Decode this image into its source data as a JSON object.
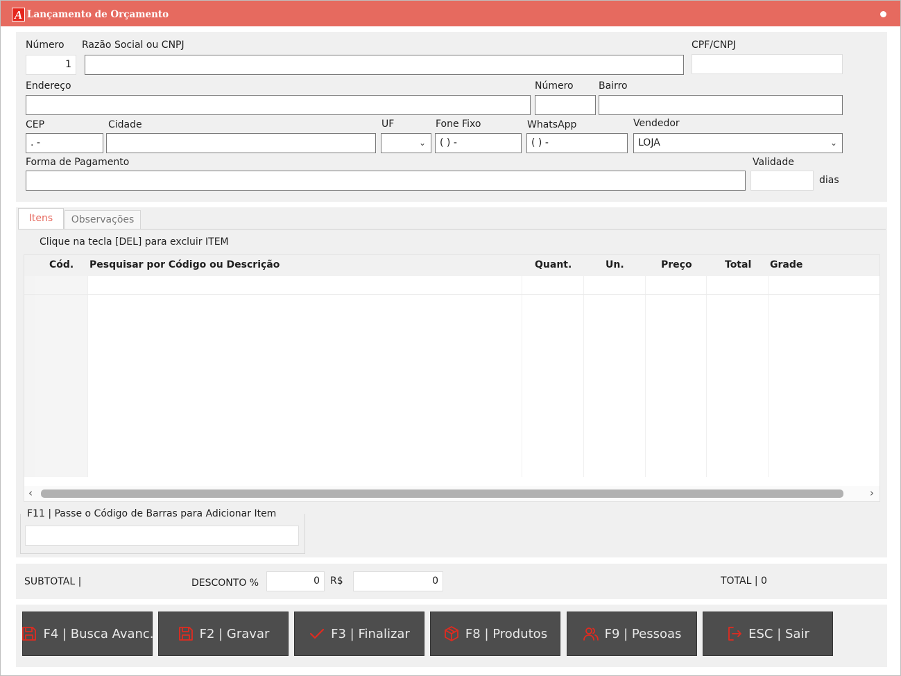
{
  "window": {
    "title": "Lançamento de Orçamento",
    "logo_letter": "A"
  },
  "header": {
    "numero_label": "Número",
    "numero_value": "1",
    "razao_label": "Razão Social ou CNPJ",
    "razao_value": "",
    "cpf_label": "CPF/CNPJ",
    "cpf_value": "",
    "endereco_label": "Endereço",
    "endereco_value": "",
    "end_numero_label": "Número",
    "end_numero_value": "",
    "bairro_label": "Bairro",
    "bairro_value": "",
    "cep_label": "CEP",
    "cep_value": " .   -",
    "cidade_label": "Cidade",
    "cidade_value": "",
    "uf_label": "UF",
    "uf_value": "",
    "fone_label": "Fone Fixo",
    "fone_value": "(  )      -",
    "whatsapp_label": "WhatsApp",
    "whatsapp_value": "(  )        -",
    "vendedor_label": "Vendedor",
    "vendedor_value": "LOJA",
    "pagamento_label": "Forma de Pagamento",
    "pagamento_value": "",
    "validade_label": "Validade",
    "validade_value": "",
    "dias_label": "dias"
  },
  "tabs": {
    "itens": "Itens",
    "observacoes": "Observações"
  },
  "items": {
    "hint": "Clique na tecla [DEL] para excluir ITEM",
    "columns": [
      "Cód.",
      "Pesquisar por Código ou Descrição",
      "Quant.",
      "Un.",
      "Preço",
      "Total",
      "Grade"
    ],
    "rows": [],
    "barcode_label": "F11 | Passe o Código de Barras para Adicionar Item",
    "barcode_value": ""
  },
  "totals": {
    "subtotal_label": "SUBTOTAL  |",
    "desconto_label": "DESCONTO %",
    "desconto_pct": "0",
    "rs_label": "R$",
    "desconto_rs": "0",
    "total_label": "TOTAL  | 0"
  },
  "buttons": {
    "busca": "F4 | Busca Avanc.",
    "gravar": "F2 | Gravar",
    "finalizar": "F3 | Finalizar",
    "produtos": "F8 | Produtos",
    "pessoas": "F9 | Pessoas",
    "sair": "ESC | Sair"
  },
  "colors": {
    "accent": "#e66a5f",
    "button_bg": "#4d4d4d",
    "icon_red": "#e02b20"
  },
  "icons": {
    "busca": "floppy-disk-icon",
    "gravar": "floppy-disk-icon",
    "finalizar": "check-icon",
    "produtos": "box-icon",
    "pessoas": "users-icon",
    "sair": "exit-icon"
  }
}
